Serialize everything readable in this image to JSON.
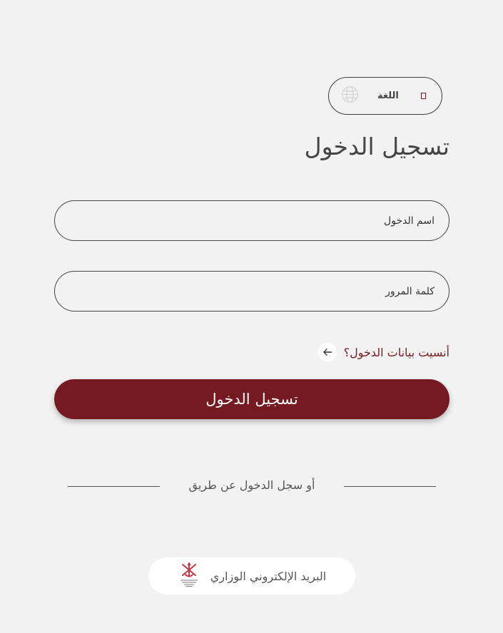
{
  "language": {
    "label": "اللغة"
  },
  "login": {
    "title": "تسجيل الدخول",
    "username_placeholder": "اسم الدخول",
    "password_placeholder": "كلمة المرور",
    "forgot_label": "أنسيت بيانات الدخول؟",
    "submit_label": "تسجيل الدخول"
  },
  "alternative": {
    "divider_label": "أو سجل الدخول عن طريق",
    "ministry_email_label": "البريد الإلكتروني الوزاري"
  },
  "colors": {
    "primary": "#761a21",
    "background": "#f2f2f2",
    "text": "#444444"
  },
  "icons": {
    "language": "globe-icon",
    "dropdown": "chevron-down-icon",
    "forgot": "arrow-left-icon",
    "ministry": "oman-emblem-icon"
  }
}
